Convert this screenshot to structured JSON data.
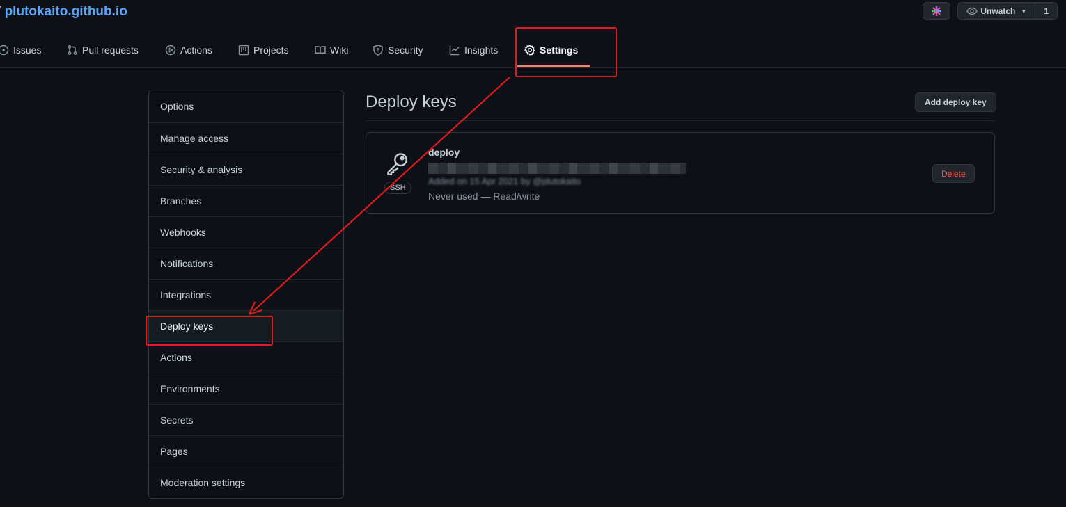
{
  "header": {
    "separator": "/",
    "repo_name": "plutokaito.github.io",
    "watch_label": "Unwatch",
    "watch_count": "1"
  },
  "tabs": [
    {
      "label": "Issues",
      "icon": "issue-opened-icon"
    },
    {
      "label": "Pull requests",
      "icon": "git-pull-request-icon"
    },
    {
      "label": "Actions",
      "icon": "play-icon"
    },
    {
      "label": "Projects",
      "icon": "project-icon"
    },
    {
      "label": "Wiki",
      "icon": "book-icon"
    },
    {
      "label": "Security",
      "icon": "shield-icon"
    },
    {
      "label": "Insights",
      "icon": "graph-icon"
    },
    {
      "label": "Settings",
      "icon": "gear-icon",
      "active": true
    }
  ],
  "sidebar": {
    "items": [
      {
        "label": "Options"
      },
      {
        "label": "Manage access"
      },
      {
        "label": "Security & analysis"
      },
      {
        "label": "Branches"
      },
      {
        "label": "Webhooks"
      },
      {
        "label": "Notifications"
      },
      {
        "label": "Integrations"
      },
      {
        "label": "Deploy keys",
        "selected": true
      },
      {
        "label": "Actions"
      },
      {
        "label": "Environments"
      },
      {
        "label": "Secrets"
      },
      {
        "label": "Pages"
      },
      {
        "label": "Moderation settings"
      }
    ]
  },
  "main": {
    "title": "Deploy keys",
    "add_button": "Add deploy key",
    "key": {
      "title": "deploy",
      "type_label": "SSH",
      "added_text": "Added on 15 Apr 2021 by @plutokaito",
      "usage": "Never used — Read/write",
      "delete_label": "Delete"
    }
  },
  "colors": {
    "background": "#0d1117",
    "link": "#58a6ff",
    "active_tab_underline": "#f78166",
    "danger": "#f85149",
    "annotation": "#e01b1b"
  }
}
